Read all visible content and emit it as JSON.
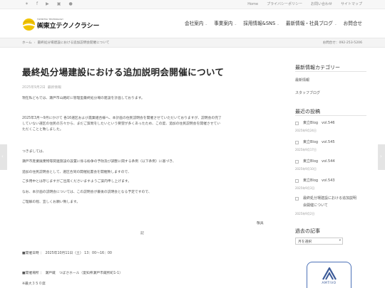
{
  "topbar": {
    "social": [
      {
        "icon": "twitter-icon",
        "glyph": "✶"
      },
      {
        "icon": "facebook-icon",
        "glyph": "f"
      },
      {
        "icon": "youtube-icon",
        "glyph": "▶"
      },
      {
        "icon": "instagram-icon",
        "glyph": "▣"
      },
      {
        "icon": "line-icon",
        "glyph": "●"
      }
    ],
    "links": [
      "Home",
      "プライバシーポリシー",
      "お問い合わせ",
      "サイトマップ"
    ]
  },
  "header": {
    "logo_small": "TOHRITSU TECHNOLOGY",
    "logo_text": "㈱東立テクノクラシー",
    "nav": [
      {
        "label": "会社案内",
        "has_dropdown": true
      },
      {
        "label": "事業案内",
        "has_dropdown": true
      },
      {
        "label": "採用情報&SNS",
        "has_dropdown": true
      },
      {
        "label": "最新情報・社員ブログ",
        "has_dropdown": true
      },
      {
        "label": "お問合せ",
        "has_dropdown": false
      }
    ]
  },
  "breadcrumb": {
    "home": "ホーム",
    "current": "最終処分場建設における追加説明会開催について",
    "phone": "お問合せ：092-253-5206"
  },
  "post": {
    "title": "最終処分場建設における追加説明会開催について",
    "date": "2025年9月2日",
    "category": "最新情報",
    "paragraphs": [
      "現在私どもでは、瀬戸市山路町に管理型最終処分場の建設を計画しております。",
      "2025年3月〜9月にかけて 各16選区および農業組合様へ、本計画の住民説明会を開催させていただいておりますが、説明会の完了",
      "していない選区の住民の方々から、まだご質問をしたいという要望が多くあったため、この度、追加の住民説明会を開催させてい",
      "ただくことと致しました。",
      "つきましては、",
      "瀬戸市産業廃棄物等関連施設の設置に係る紛争の予防及び調整に関する条例（以下条例）に基づき、",
      "追加の住民説明会として、選区合同の開催処置会を開催致しますので、",
      "ご多用中とは存じますがご出席くださいますようご案内申し上げます。",
      "なお、本計画の説明会については、この説明会が最後の説明会となる予定ですので、",
      "ご理解の程、宜しくお願い致します。",
      "敬具",
      "記",
      "■開催日時 ：　2025年10月11日（土） 13：00〜16：00",
      "■開催場所 ：　瀬戸蔵　つばさホール（愛知県瀬戸市蔵所町1-1）",
      "※最大３５０席"
    ]
  },
  "sidebar": {
    "categories_title": "最新情報カテゴリー",
    "categories": [
      "最新情報",
      "スタッフブログ"
    ],
    "recent_title": "最近の投稿",
    "recent": [
      {
        "title": "東立Blog　vol.546",
        "date": "2025年9月24日"
      },
      {
        "title": "東立Blog　vol.545",
        "date": "2025年9月17日"
      },
      {
        "title": "東立Blog　vol.544",
        "date": "2025年9月10日"
      },
      {
        "title": "東立Blog　vol.543",
        "date": "2025年9月3日"
      },
      {
        "title_line1": "最終処分場建設における追加説明",
        "title_line2": "会開催について",
        "date": "2025年9月2日"
      }
    ],
    "archive_title": "過去の記事",
    "archive_select": "月を選択",
    "banner_text": "AMTIVO"
  },
  "colors": {
    "accent_yellow": "#f1c400",
    "banner_blue": "#3b5a98"
  }
}
